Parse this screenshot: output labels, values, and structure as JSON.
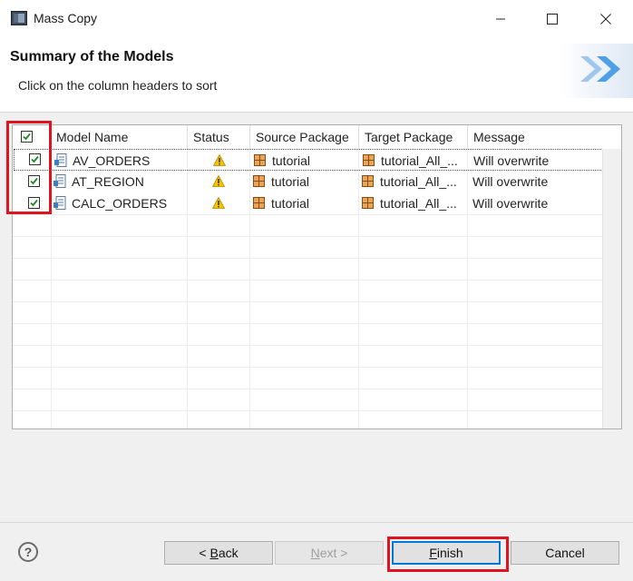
{
  "window": {
    "title": "Mass Copy",
    "app_icon": "eclipse-window-icon",
    "controls": [
      "minimize-icon",
      "maximize-icon",
      "close-icon"
    ]
  },
  "header": {
    "title": "Summary of the Models",
    "subtitle": "Click on the column headers to sort"
  },
  "table": {
    "columns": [
      "Model Name",
      "Status",
      "Source Package",
      "Target Package",
      "Message"
    ],
    "select_all_checked": true,
    "rows": [
      {
        "checked": true,
        "model_name": "AV_ORDERS",
        "status_icon": "warning-icon",
        "source_package": "tutorial",
        "target_package": "tutorial_All_...",
        "message": "Will overwrite"
      },
      {
        "checked": true,
        "model_name": "AT_REGION",
        "status_icon": "warning-icon",
        "source_package": "tutorial",
        "target_package": "tutorial_All_...",
        "message": "Will overwrite"
      },
      {
        "checked": true,
        "model_name": "CALC_ORDERS",
        "status_icon": "warning-icon",
        "source_package": "tutorial",
        "target_package": "tutorial_All_...",
        "message": "Will overwrite"
      }
    ]
  },
  "footer": {
    "help": "?",
    "back_prefix": "< ",
    "back_mnemonic": "B",
    "back_rest": "ack",
    "next_mnemonic": "N",
    "next_rest": "ext >",
    "finish_mnemonic": "F",
    "finish_rest": "inish",
    "cancel": "Cancel"
  },
  "colors": {
    "highlight": "#e0141e",
    "default_button_border": "#0078d7",
    "warning": "#f5c400",
    "package": "#b5651d"
  }
}
